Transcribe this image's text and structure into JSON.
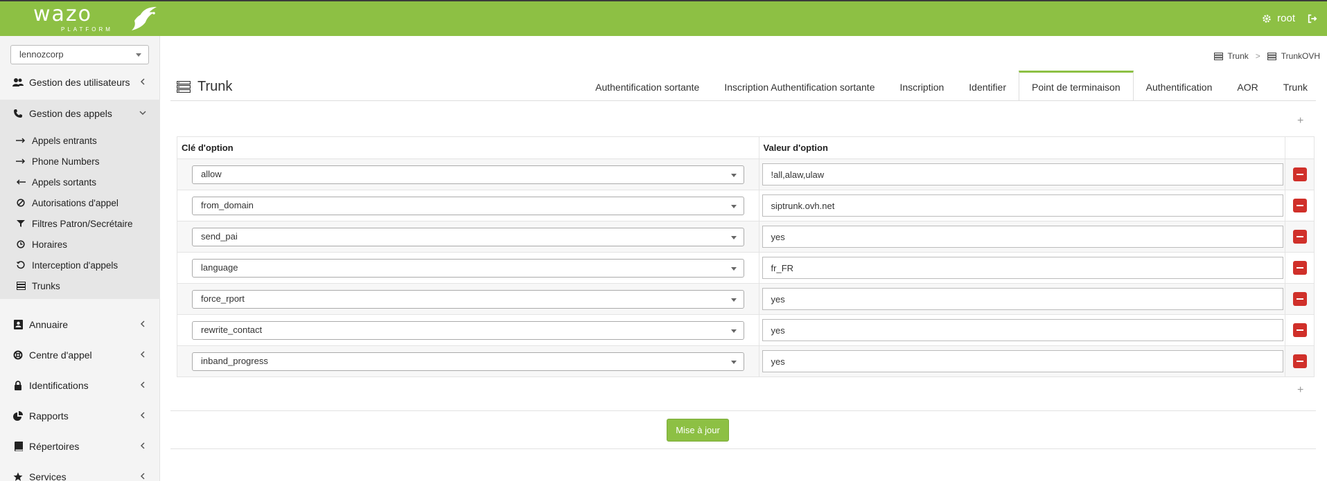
{
  "header": {
    "brand": "wazo",
    "brand_sub": "PLATFORM",
    "user": "root"
  },
  "sidebar": {
    "tenant": "lennozcorp",
    "items": [
      {
        "label": "Gestion des utilisateurs",
        "icon": "users-icon"
      },
      {
        "label": "Gestion des appels",
        "icon": "phone-icon"
      },
      {
        "label": "Annuaire",
        "icon": "address-book-icon"
      },
      {
        "label": "Centre d'appel",
        "icon": "lifebuoy-icon"
      },
      {
        "label": "Identifications",
        "icon": "lock-icon"
      },
      {
        "label": "Rapports",
        "icon": "pie-chart-icon"
      },
      {
        "label": "Répertoires",
        "icon": "book-icon"
      },
      {
        "label": "Services",
        "icon": "star-icon"
      }
    ],
    "sub_items": [
      {
        "label": "Appels entrants",
        "icon": "arrow-right-icon"
      },
      {
        "label": "Phone Numbers",
        "icon": "arrow-right-icon"
      },
      {
        "label": "Appels sortants",
        "icon": "arrow-left-icon"
      },
      {
        "label": "Autorisations d'appel",
        "icon": "ban-icon"
      },
      {
        "label": "Filtres Patron/Secrétaire",
        "icon": "filter-icon"
      },
      {
        "label": "Horaires",
        "icon": "clock-icon"
      },
      {
        "label": "Interception d'appels",
        "icon": "history-icon"
      },
      {
        "label": "Trunks",
        "icon": "server-icon"
      }
    ]
  },
  "breadcrumb": {
    "parent": "Trunk",
    "current": "TrunkOVH"
  },
  "page": {
    "title": "Trunk"
  },
  "tabs": [
    "Authentification sortante",
    "Inscription Authentification sortante",
    "Inscription",
    "Identifier",
    "Point de terminaison",
    "Authentification",
    "AOR",
    "Trunk"
  ],
  "active_tab": "Point de terminaison",
  "table": {
    "col_key": "Clé d'option",
    "col_value": "Valeur d'option",
    "rows": [
      {
        "key": "allow",
        "value": "!all,alaw,ulaw"
      },
      {
        "key": "from_domain",
        "value": "siptrunk.ovh.net"
      },
      {
        "key": "send_pai",
        "value": "yes"
      },
      {
        "key": "language",
        "value": "fr_FR"
      },
      {
        "key": "force_rport",
        "value": "yes"
      },
      {
        "key": "rewrite_contact",
        "value": "yes"
      },
      {
        "key": "inband_progress",
        "value": "yes"
      }
    ]
  },
  "actions": {
    "update": "Mise à jour",
    "add": "+"
  },
  "colors": {
    "brand": "#8dc044",
    "danger": "#d0302a"
  }
}
